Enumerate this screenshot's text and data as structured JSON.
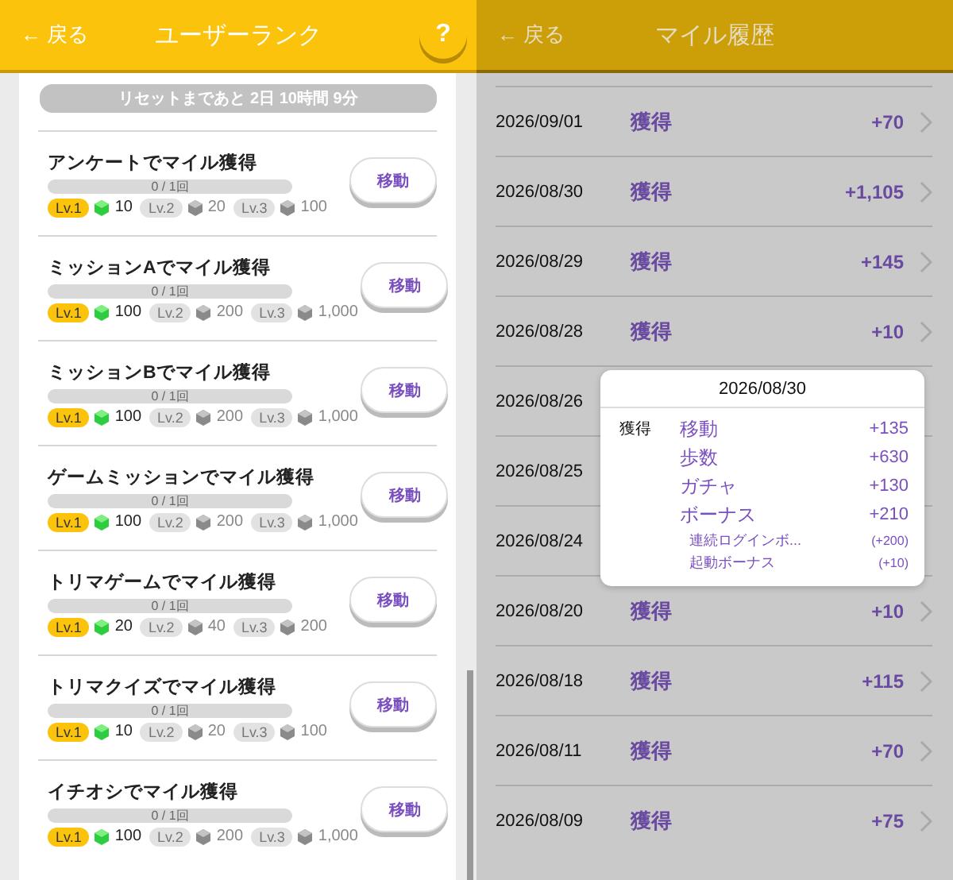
{
  "left_screen": {
    "header": {
      "back": "← 戻る",
      "title": "ユーザーランク",
      "help": "?"
    },
    "reset_notice": "リセットまであと 2日 10時間 9分",
    "missions": [
      {
        "title": "アンケートでマイル獲得",
        "progress": "0 / 1回",
        "level": 0,
        "button": "移動",
        "tiers": [
          {
            "label": "Lv.1",
            "reward": "10",
            "reached": true
          },
          {
            "label": "Lv.2",
            "reward": "20",
            "reached": false
          },
          {
            "label": "Lv.3",
            "reward": "100",
            "reached": false
          }
        ]
      },
      {
        "title": "ミッションAでマイル獲得",
        "progress": "0 / 1回",
        "level": 0,
        "button": "移動",
        "tiers": [
          {
            "label": "Lv.1",
            "reward": "100",
            "reached": true
          },
          {
            "label": "Lv.2",
            "reward": "200",
            "reached": false
          },
          {
            "label": "Lv.3",
            "reward": "1,000",
            "reached": false
          }
        ]
      },
      {
        "title": "ミッションBでマイル獲得",
        "progress": "0 / 1回",
        "level": 0,
        "button": "移動",
        "tiers": [
          {
            "label": "Lv.1",
            "reward": "100",
            "reached": true
          },
          {
            "label": "Lv.2",
            "reward": "200",
            "reached": false
          },
          {
            "label": "Lv.3",
            "reward": "1,000",
            "reached": false
          }
        ]
      },
      {
        "title": "ゲームミッションでマイル獲得",
        "progress": "0 / 1回",
        "level": 0,
        "button": "移動",
        "tiers": [
          {
            "label": "Lv.1",
            "reward": "100",
            "reached": true
          },
          {
            "label": "Lv.2",
            "reward": "200",
            "reached": false
          },
          {
            "label": "Lv.3",
            "reward": "1,000",
            "reached": false
          }
        ]
      },
      {
        "title": "トリマゲームでマイル獲得",
        "progress": "0 / 1回",
        "level": 0,
        "button": "移動",
        "tiers": [
          {
            "label": "Lv.1",
            "reward": "20",
            "reached": true
          },
          {
            "label": "Lv.2",
            "reward": "40",
            "reached": false
          },
          {
            "label": "Lv.3",
            "reward": "200",
            "reached": false
          }
        ]
      },
      {
        "title": "トリマクイズでマイル獲得",
        "progress": "0 / 1回",
        "level": 0,
        "button": "移動",
        "tiers": [
          {
            "label": "Lv.1",
            "reward": "10",
            "reached": true
          },
          {
            "label": "Lv.2",
            "reward": "20",
            "reached": false
          },
          {
            "label": "Lv.3",
            "reward": "100",
            "reached": false
          }
        ]
      },
      {
        "title": "イチオシでマイル獲得",
        "progress": "0 / 1回",
        "level": 0,
        "button": "移動",
        "tiers": [
          {
            "label": "Lv.1",
            "reward": "100",
            "reached": true
          },
          {
            "label": "Lv.2",
            "reward": "200",
            "reached": false
          },
          {
            "label": "Lv.3",
            "reward": "1,000",
            "reached": false
          }
        ]
      }
    ]
  },
  "right_screen": {
    "header": {
      "back": "← 戻る",
      "title": "マイル履歴"
    },
    "history": [
      {
        "date": "2026/09/01",
        "type": "獲得",
        "amount": "+70"
      },
      {
        "date": "2026/08/30",
        "type": "獲得",
        "amount": "+1,105"
      },
      {
        "date": "2026/08/29",
        "type": "獲得",
        "amount": "+145"
      },
      {
        "date": "2026/08/28",
        "type": "獲得",
        "amount": "+10"
      },
      {
        "date": "2026/08/26"
      },
      {
        "date": "2026/08/25"
      },
      {
        "date": "2026/08/24"
      },
      {
        "date": "2026/08/20",
        "type": "獲得",
        "amount": "+10"
      },
      {
        "date": "2026/08/18",
        "type": "獲得",
        "amount": "+115"
      },
      {
        "date": "2026/08/11",
        "type": "獲得",
        "amount": "+70"
      },
      {
        "date": "2026/08/09",
        "type": "獲得",
        "amount": "+75"
      }
    ],
    "popup": {
      "date": "2026/08/30",
      "type": "獲得",
      "items": [
        {
          "kind": "main",
          "label": "移動",
          "amount": "+135"
        },
        {
          "kind": "main",
          "label": "歩数",
          "amount": "+630"
        },
        {
          "kind": "main",
          "label": "ガチャ",
          "amount": "+130"
        },
        {
          "kind": "main",
          "label": "ボーナス",
          "amount": "+210"
        },
        {
          "kind": "sub",
          "label": "連続ログインボ...",
          "amount": "(+200)"
        },
        {
          "kind": "sub",
          "label": "起動ボーナス",
          "amount": "(+10)"
        }
      ]
    }
  }
}
